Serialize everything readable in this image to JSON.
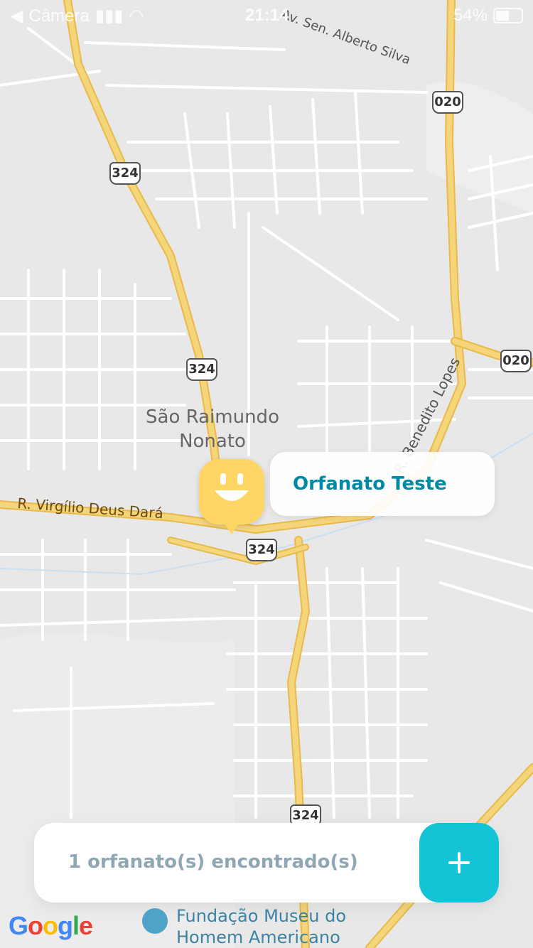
{
  "status_bar": {
    "back_app": "Câmera",
    "time": "21:14",
    "battery": "54%"
  },
  "map": {
    "roads_shields": [
      "324",
      "324",
      "324",
      "324",
      "020",
      "020"
    ],
    "labels": {
      "city": [
        "São Raimundo",
        "Nonato"
      ],
      "street_top": "Av. Sen. Alberto Silva",
      "street_right": "R. Benedito Lopes",
      "street_left": "R. Virgílio Deus Dará",
      "poi": [
        "Fundação Museu do",
        "Homem Americano"
      ]
    },
    "branding": "Google",
    "colors": {
      "map_bg": "#e8e8e8",
      "road": "#ffffff",
      "highway": "#f5d57a",
      "highway_edge": "#e8b94b"
    }
  },
  "pin": {
    "icon": "smile-icon",
    "color": "#ffd666"
  },
  "callout": {
    "name": "Orfanato Teste",
    "text_color": "#0089a5"
  },
  "footer": {
    "count_text": "1 orfanato(s) encontrado(s)",
    "add_icon": "plus-icon",
    "accent": "#15c3d6"
  }
}
